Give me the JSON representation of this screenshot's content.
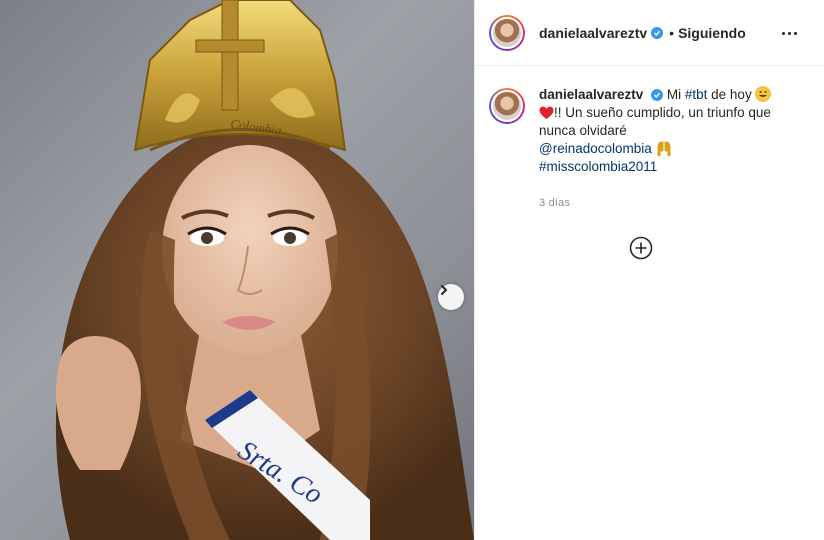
{
  "post": {
    "username": "danielaalvareztv",
    "follow_status": "Siguiendo",
    "separator": "•",
    "caption": {
      "intro": "Mi",
      "hashtag_tbt": "#tbt",
      "text_after_tbt": "de hoy",
      "line2": "!! Un sueño cumplido, un triunfo que nunca olvidaré",
      "mention": "@reinadocolombia",
      "hashtag_2": "#misscolombia2011"
    },
    "time_ago": "3 días"
  },
  "photo": {
    "crown_text": "Colombia",
    "sash_text": "Srta. Co"
  },
  "icons": {
    "verified": "verified-badge-icon",
    "more": "more-options-icon",
    "next": "chevron-right-icon",
    "load_more": "plus-circle-icon",
    "emoji_grin": "grinning-face-icon",
    "emoji_heart": "red-heart-icon",
    "emoji_hands": "raised-hands-icon"
  },
  "colors": {
    "link": "#00376b",
    "verified": "#3897f0",
    "text": "#262626",
    "muted": "#8e8e8e",
    "divider": "#efefef"
  }
}
